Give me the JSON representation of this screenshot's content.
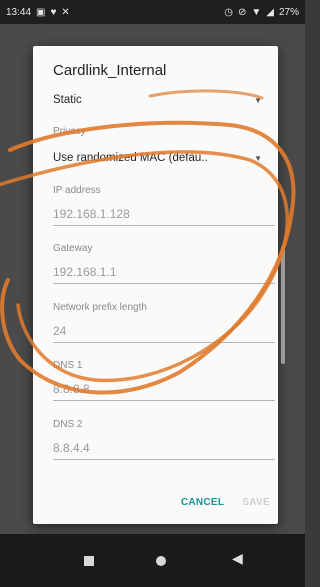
{
  "statusbar": {
    "time": "13:44",
    "battery": "27%"
  },
  "dialog": {
    "title": "Cardlink_Internal",
    "ip_settings": {
      "value": "Static"
    },
    "privacy": {
      "label": "Privacy",
      "value": "Use randomized MAC (defau.."
    },
    "ip_address": {
      "label": "IP address",
      "value": "192.168.1.128"
    },
    "gateway": {
      "label": "Gateway",
      "value": "192.168.1.1"
    },
    "prefix": {
      "label": "Network prefix length",
      "value": "24"
    },
    "dns1": {
      "label": "DNS 1",
      "value": "8.8.8.8"
    },
    "dns2": {
      "label": "DNS 2",
      "value": "8.8.4.4"
    },
    "cancel_label": "CANCEL",
    "save_label": "SAVE"
  },
  "colors": {
    "accent": "#15959a",
    "annotation": "#e07a2c"
  }
}
